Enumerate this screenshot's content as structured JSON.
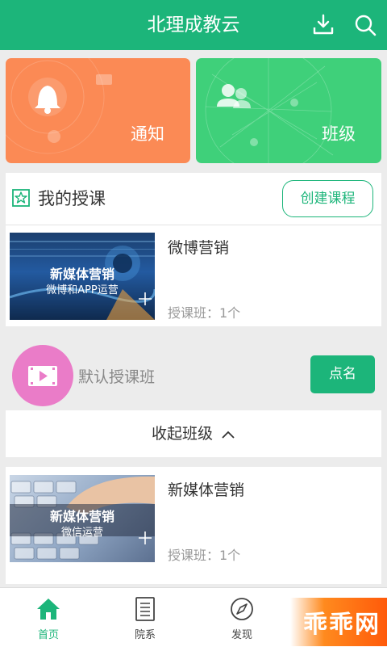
{
  "header": {
    "title": "北理成教云"
  },
  "tiles": {
    "notice": "通知",
    "classes": "班级"
  },
  "my_courses": {
    "heading": "我的授课",
    "create_label": "创建课程",
    "courses": [
      {
        "name": "微博营销",
        "count": "授课班：1个",
        "thumb_title": "新媒体营销",
        "thumb_sub": "微博和APP运营"
      }
    ]
  },
  "class_row": {
    "name": "默认授课班",
    "rollcall_label": "点名"
  },
  "collapse_label": "收起班级",
  "course2": {
    "name": "新媒体营销",
    "count": "授课班：1个",
    "thumb_title": "新媒体营销",
    "thumb_sub": "微信运营"
  },
  "tabbar": {
    "tabs": [
      {
        "label": "首页",
        "icon": "home-icon",
        "active": true
      },
      {
        "label": "院系",
        "icon": "list-icon"
      },
      {
        "label": "发现",
        "icon": "compass-icon"
      },
      {
        "label": "",
        "icon": "profile-icon"
      }
    ]
  },
  "watermark": "乖乖网",
  "colors": {
    "primary": "#1cb57a",
    "notice_tile": "#fb8a55",
    "class_tile": "#3fd07a",
    "play_circle": "#ea7cc8"
  }
}
